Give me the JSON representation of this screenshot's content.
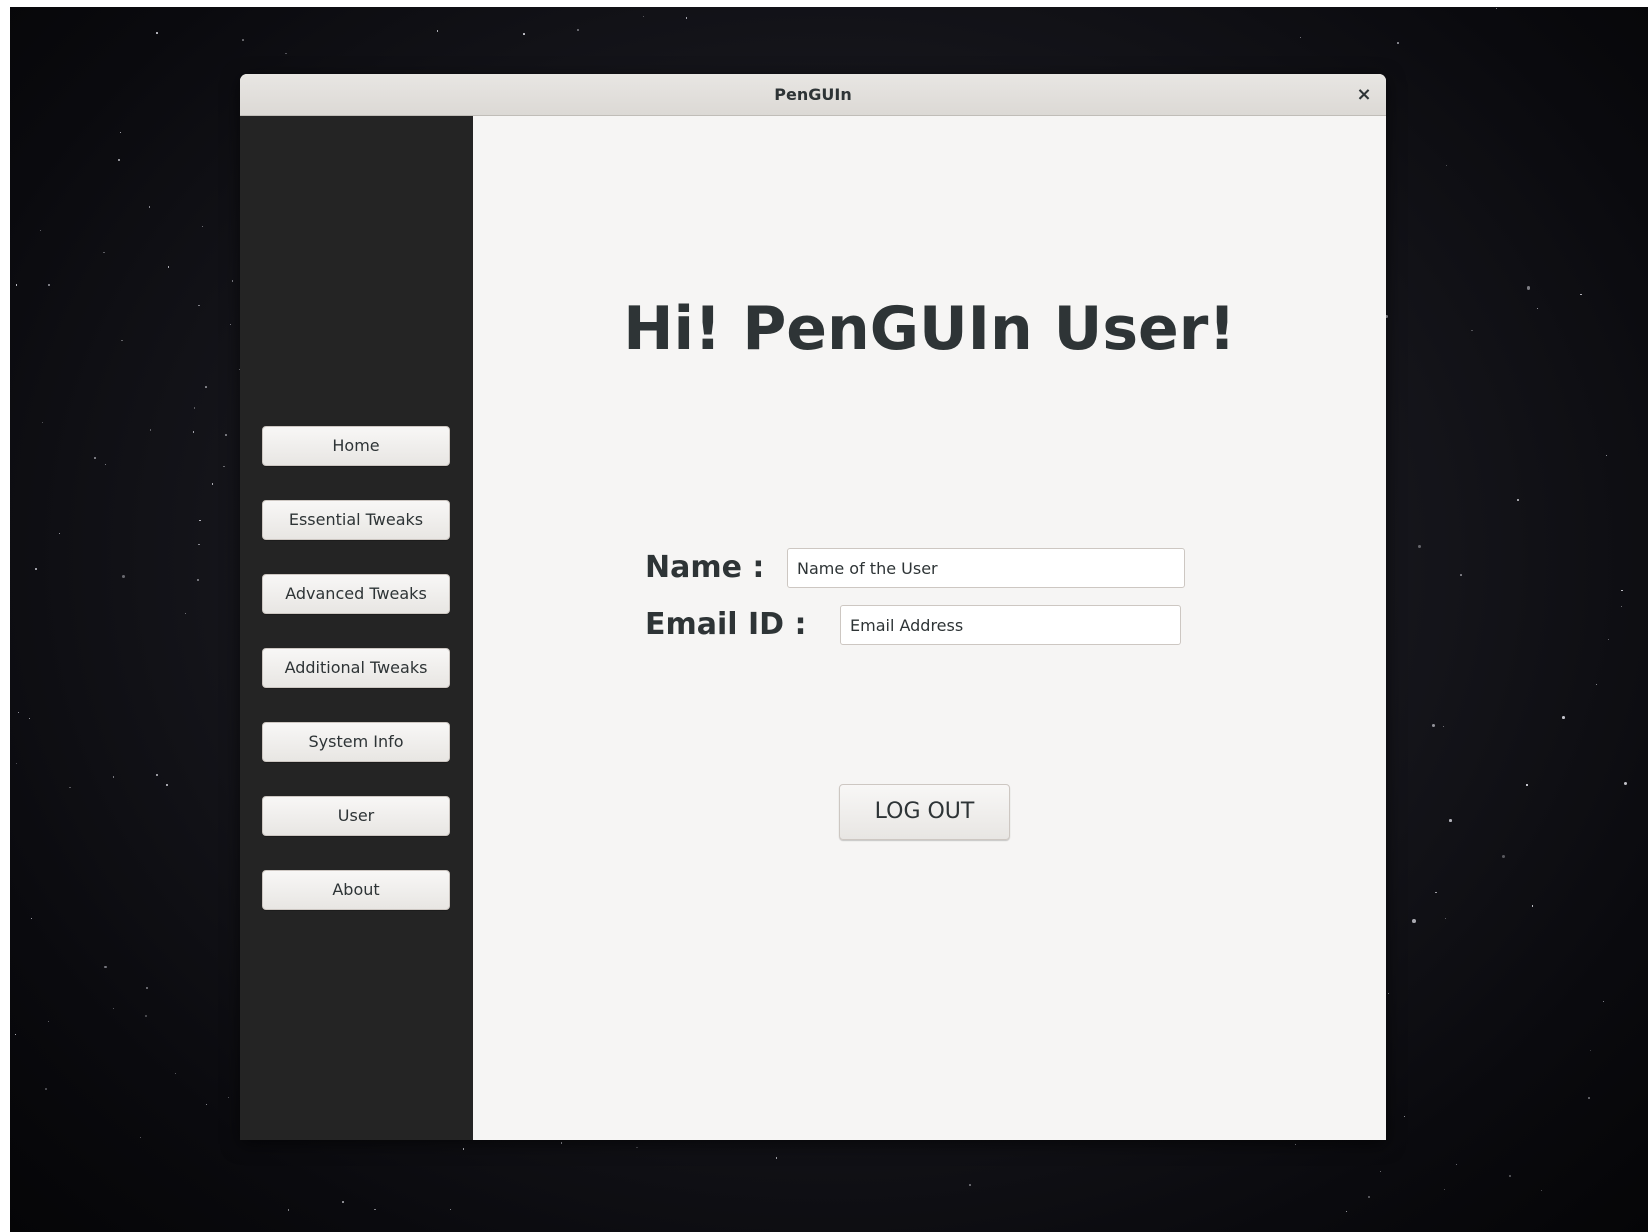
{
  "window": {
    "title": "PenGUIn",
    "close_glyph": "×"
  },
  "sidebar": {
    "items": [
      {
        "label": "Home"
      },
      {
        "label": "Essential Tweaks"
      },
      {
        "label": "Advanced Tweaks"
      },
      {
        "label": "Additional Tweaks"
      },
      {
        "label": "System Info"
      },
      {
        "label": "User"
      },
      {
        "label": "About"
      }
    ]
  },
  "main": {
    "heading": "Hi! PenGUIn User!",
    "name_label": "Name :",
    "name_value": "Name of the User",
    "email_label": "Email ID :",
    "email_value": "Email Address",
    "logout_label": "LOG OUT"
  },
  "colors": {
    "sidebar_bg": "#242424",
    "content_bg": "#f6f5f4",
    "text": "#2e3436"
  }
}
